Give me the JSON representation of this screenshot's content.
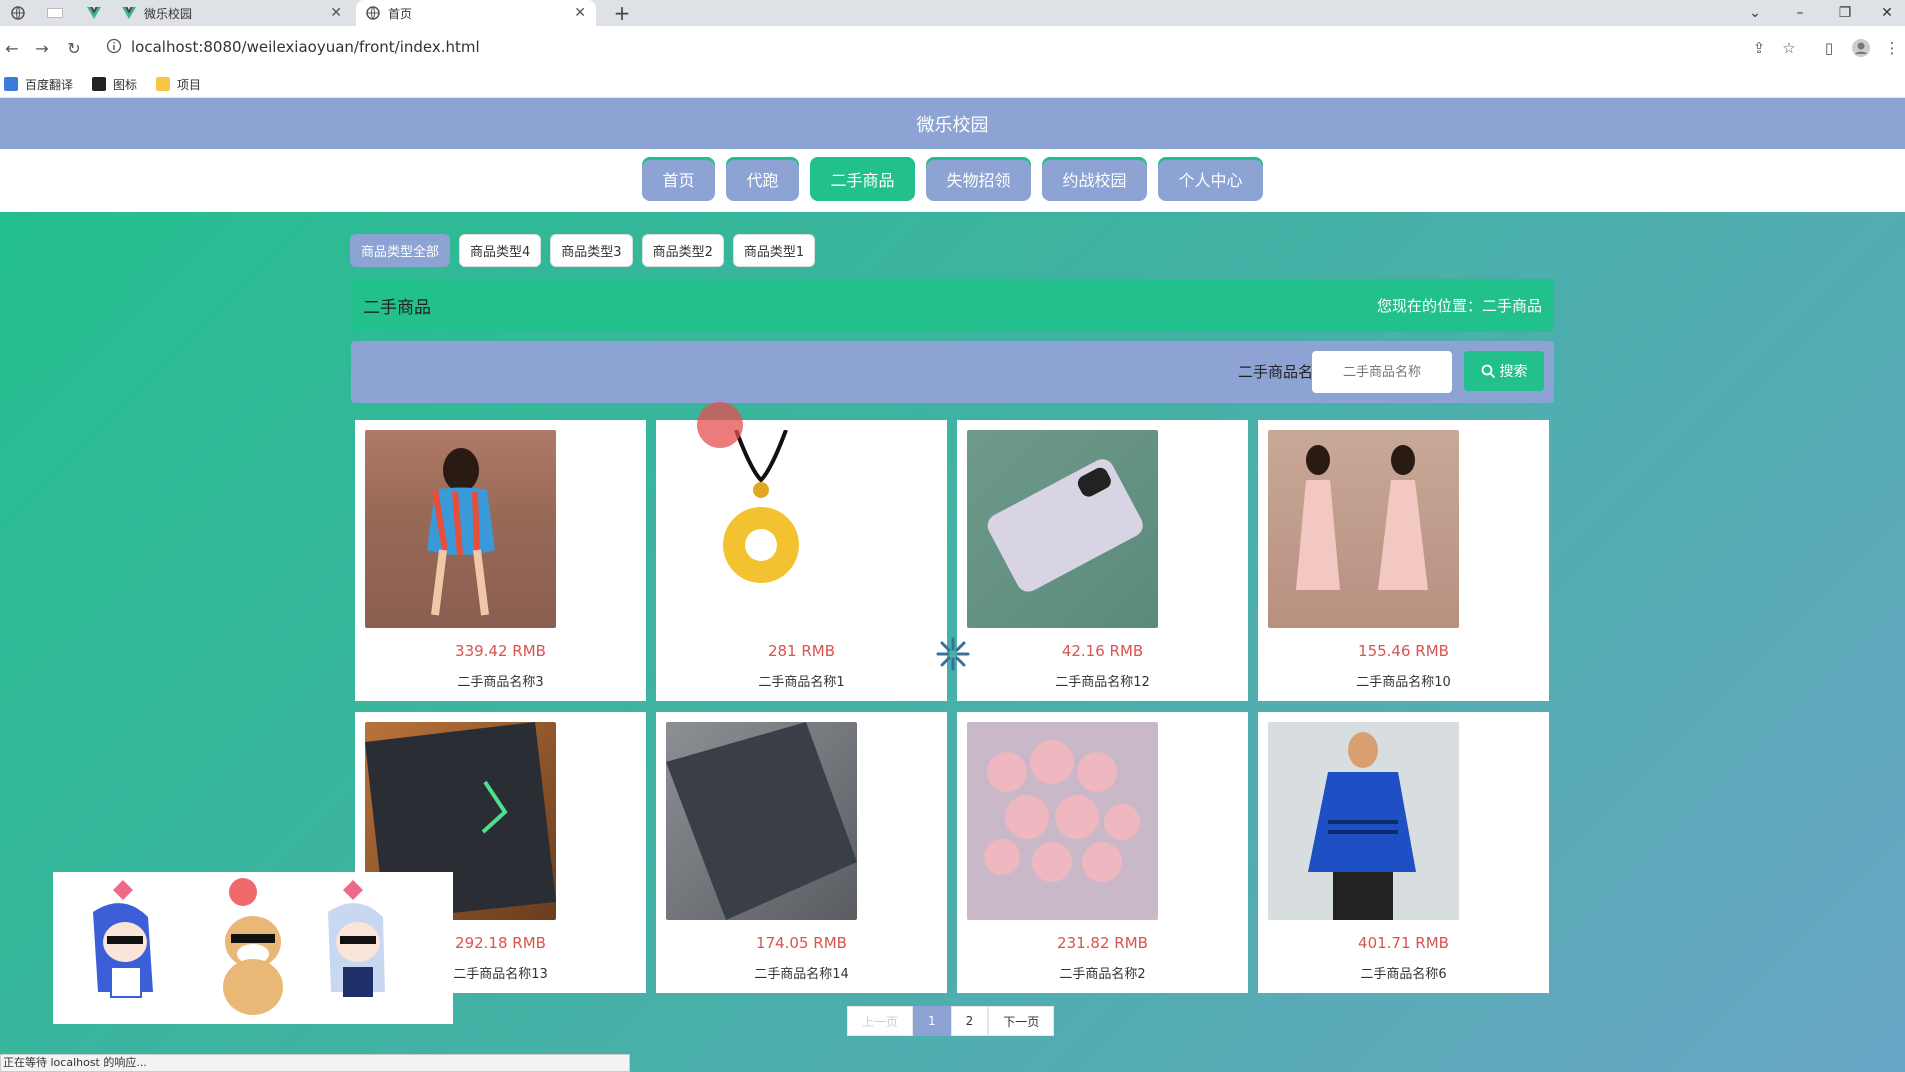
{
  "browser": {
    "tabs": [
      {
        "label": "微乐校园",
        "active": false
      },
      {
        "label": "首页",
        "active": true
      }
    ],
    "url": "localhost:8080/weilexiaoyuan/front/index.html",
    "bookmarks": [
      "百度翻译",
      "图标",
      "项目"
    ],
    "status_text": "正在等待 localhost 的响应..."
  },
  "site": {
    "title": "微乐校园",
    "nav": [
      {
        "label": "首页",
        "active": false
      },
      {
        "label": "代跑",
        "active": false
      },
      {
        "label": "二手商品",
        "active": true
      },
      {
        "label": "失物招领",
        "active": false
      },
      {
        "label": "约战校园",
        "active": false
      },
      {
        "label": "个人中心",
        "active": false
      }
    ]
  },
  "types": [
    "商品类型全部",
    "商品类型4",
    "商品类型3",
    "商品类型2",
    "商品类型1"
  ],
  "section": {
    "title": "二手商品",
    "location": "您现在的位置：二手商品"
  },
  "search": {
    "label": "二手商品名称",
    "placeholder": "二手商品名称",
    "button": "搜索"
  },
  "products": [
    {
      "price": "339.42 RMB",
      "name": "二手商品名称3"
    },
    {
      "price": "281 RMB",
      "name": "二手商品名称1"
    },
    {
      "price": "42.16 RMB",
      "name": "二手商品名称12"
    },
    {
      "price": "155.46 RMB",
      "name": "二手商品名称10"
    },
    {
      "price": "292.18 RMB",
      "name": "二手商品名称13"
    },
    {
      "price": "174.05 RMB",
      "name": "二手商品名称14"
    },
    {
      "price": "231.82 RMB",
      "name": "二手商品名称2"
    },
    {
      "price": "401.71 RMB",
      "name": "二手商品名称6"
    }
  ],
  "pager": {
    "prev": "上一页",
    "pages": [
      "1",
      "2"
    ],
    "current": "1",
    "next": "下一页"
  },
  "colors": {
    "accent_green": "#21c08c",
    "nav_blue": "#8ca3d3",
    "price_red": "#d9534f"
  }
}
